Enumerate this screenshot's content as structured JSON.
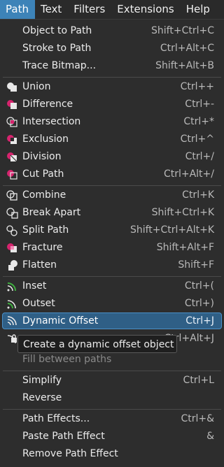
{
  "menubar": {
    "items": [
      {
        "label": "Path"
      },
      {
        "label": "Text"
      },
      {
        "label": "Filters"
      },
      {
        "label": "Extensions"
      },
      {
        "label": "Help"
      }
    ]
  },
  "menu": {
    "items": [
      {
        "label": "Object to Path",
        "shortcut": "Shift+Ctrl+C"
      },
      {
        "label": "Stroke to Path",
        "shortcut": "Ctrl+Alt+C"
      },
      {
        "label": "Trace Bitmap...",
        "shortcut": "Shift+Alt+B"
      },
      {
        "label": "Union",
        "shortcut": "Ctrl++",
        "icon": "union-icon"
      },
      {
        "label": "Difference",
        "shortcut": "Ctrl+-",
        "icon": "difference-icon"
      },
      {
        "label": "Intersection",
        "shortcut": "Ctrl+*",
        "icon": "intersection-icon"
      },
      {
        "label": "Exclusion",
        "shortcut": "Ctrl+^",
        "icon": "exclusion-icon"
      },
      {
        "label": "Division",
        "shortcut": "Ctrl+/",
        "icon": "division-icon"
      },
      {
        "label": "Cut Path",
        "shortcut": "Ctrl+Alt+/",
        "icon": "cut-path-icon"
      },
      {
        "label": "Combine",
        "shortcut": "Ctrl+K",
        "icon": "combine-icon"
      },
      {
        "label": "Break Apart",
        "shortcut": "Shift+Ctrl+K",
        "icon": "break-apart-icon"
      },
      {
        "label": "Split Path",
        "shortcut": "Shift+Ctrl+Alt+K",
        "icon": "split-path-icon"
      },
      {
        "label": "Fracture",
        "shortcut": "Shift+Alt+F",
        "icon": "fracture-icon"
      },
      {
        "label": "Flatten",
        "shortcut": "Shift+F",
        "icon": "flatten-icon"
      },
      {
        "label": "Inset",
        "shortcut": "Ctrl+(",
        "icon": "inset-icon"
      },
      {
        "label": "Outset",
        "shortcut": "Ctrl+)",
        "icon": "outset-icon"
      },
      {
        "label": "Dynamic Offset",
        "shortcut": "Ctrl+J",
        "icon": "dynamic-offset-icon"
      },
      {
        "label": "",
        "shortcut": "Ctrl+Alt+J",
        "icon": "linked-offset-icon"
      },
      {
        "label": "Fill between paths",
        "shortcut": ""
      },
      {
        "label": "Simplify",
        "shortcut": "Ctrl+L"
      },
      {
        "label": "Reverse",
        "shortcut": ""
      },
      {
        "label": "Path Effects...",
        "shortcut": "Ctrl+&"
      },
      {
        "label": "Paste Path Effect",
        "shortcut": "&"
      },
      {
        "label": "Remove Path Effect",
        "shortcut": ""
      }
    ],
    "tooltip": "Create a dynamic offset object"
  },
  "colors": {
    "accent": "#3d83b8",
    "highlight": "#2f5f86",
    "boolean_pink": "#d6246e",
    "offset_green": "#3fae3f"
  }
}
